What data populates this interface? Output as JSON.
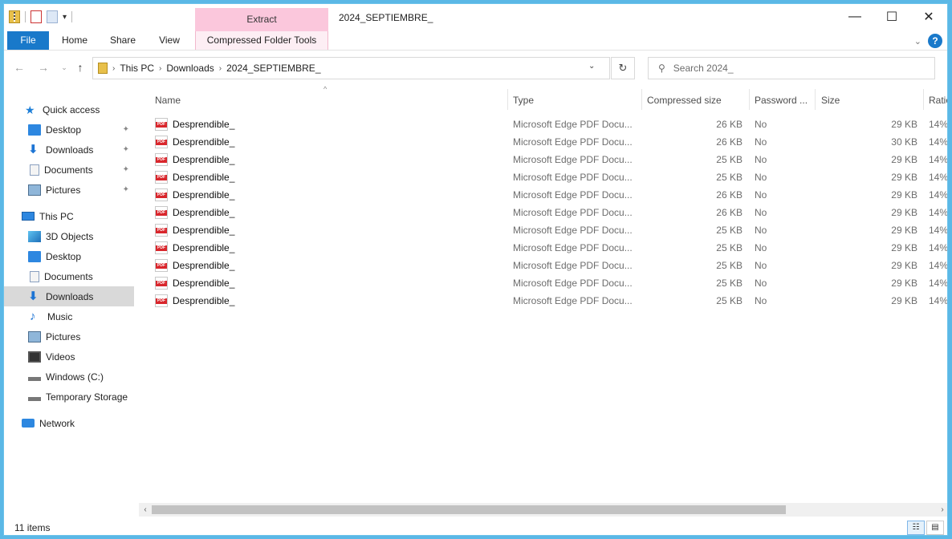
{
  "window": {
    "title": "2024_SEPTIEMBRE_",
    "context_tab_header": "Extract",
    "controls": {
      "minimize": "—",
      "maximize": "☐",
      "close": "✕"
    }
  },
  "ribbon": {
    "tabs": [
      "File",
      "Home",
      "Share",
      "View",
      "Compressed Folder Tools"
    ],
    "collapse": "⌄",
    "help": "?"
  },
  "address": {
    "crumbs": [
      "This PC",
      "Downloads",
      "2024_SEPTIEMBRE_"
    ],
    "separator": "›",
    "dropdown": "⌄",
    "refresh": "↻"
  },
  "search": {
    "placeholder": "Search 2024_",
    "icon": "⚲"
  },
  "nav": {
    "back": "←",
    "forward": "→",
    "recent": "⌄",
    "up": "↑"
  },
  "sidebar": {
    "items": [
      {
        "label": "Quick access",
        "icon": "star-icon",
        "pinned": false
      },
      {
        "label": "Desktop",
        "icon": "desktop-icon",
        "pinned": true
      },
      {
        "label": "Downloads",
        "icon": "downloads-icon",
        "pinned": true
      },
      {
        "label": "Documents",
        "icon": "documents-icon",
        "pinned": true
      },
      {
        "label": "Pictures",
        "icon": "pictures-icon",
        "pinned": true
      },
      {
        "label": "This PC",
        "icon": "pc-icon",
        "pinned": false
      },
      {
        "label": "3D Objects",
        "icon": "3d-objects-icon",
        "pinned": false
      },
      {
        "label": "Desktop",
        "icon": "desktop-icon",
        "pinned": false
      },
      {
        "label": "Documents",
        "icon": "documents-icon",
        "pinned": false
      },
      {
        "label": "Downloads",
        "icon": "downloads-icon",
        "pinned": false,
        "selected": true
      },
      {
        "label": "Music",
        "icon": "music-icon",
        "pinned": false
      },
      {
        "label": "Pictures",
        "icon": "pictures-icon",
        "pinned": false
      },
      {
        "label": "Videos",
        "icon": "videos-icon",
        "pinned": false
      },
      {
        "label": "Windows (C:)",
        "icon": "drive-icon",
        "pinned": false
      },
      {
        "label": "Temporary Storage",
        "icon": "drive-icon",
        "pinned": false
      },
      {
        "label": "Network",
        "icon": "network-icon",
        "pinned": false
      }
    ],
    "pin_glyph": "📌"
  },
  "columns": [
    "Name",
    "Type",
    "Compressed size",
    "Password ...",
    "Size",
    "Ratio"
  ],
  "sort_glyph": "^",
  "files": [
    {
      "name": "Desprendible_",
      "type": "Microsoft Edge PDF Docu...",
      "compressed": "26 KB",
      "password": "No",
      "size": "29 KB",
      "ratio": "14%"
    },
    {
      "name": "Desprendible_",
      "type": "Microsoft Edge PDF Docu...",
      "compressed": "26 KB",
      "password": "No",
      "size": "30 KB",
      "ratio": "14%"
    },
    {
      "name": "Desprendible_",
      "type": "Microsoft Edge PDF Docu...",
      "compressed": "25 KB",
      "password": "No",
      "size": "29 KB",
      "ratio": "14%"
    },
    {
      "name": "Desprendible_",
      "type": "Microsoft Edge PDF Docu...",
      "compressed": "25 KB",
      "password": "No",
      "size": "29 KB",
      "ratio": "14%"
    },
    {
      "name": "Desprendible_",
      "type": "Microsoft Edge PDF Docu...",
      "compressed": "26 KB",
      "password": "No",
      "size": "29 KB",
      "ratio": "14%"
    },
    {
      "name": "Desprendible_",
      "type": "Microsoft Edge PDF Docu...",
      "compressed": "26 KB",
      "password": "No",
      "size": "29 KB",
      "ratio": "14%"
    },
    {
      "name": "Desprendible_",
      "type": "Microsoft Edge PDF Docu...",
      "compressed": "25 KB",
      "password": "No",
      "size": "29 KB",
      "ratio": "14%"
    },
    {
      "name": "Desprendible_",
      "type": "Microsoft Edge PDF Docu...",
      "compressed": "25 KB",
      "password": "No",
      "size": "29 KB",
      "ratio": "14%"
    },
    {
      "name": "Desprendible_",
      "type": "Microsoft Edge PDF Docu...",
      "compressed": "25 KB",
      "password": "No",
      "size": "29 KB",
      "ratio": "14%"
    },
    {
      "name": "Desprendible_",
      "type": "Microsoft Edge PDF Docu...",
      "compressed": "25 KB",
      "password": "No",
      "size": "29 KB",
      "ratio": "14%"
    },
    {
      "name": "Desprendible_",
      "type": "Microsoft Edge PDF Docu...",
      "compressed": "25 KB",
      "password": "No",
      "size": "29 KB",
      "ratio": "14%"
    }
  ],
  "scroll": {
    "left": "‹",
    "right": "›"
  },
  "status": {
    "count": "11 items",
    "details_view": "☷",
    "tiles_view": "▤"
  },
  "colors": {
    "accent": "#1979ca",
    "context_tab": "#fbc7dc",
    "selected": "#d9d9d9",
    "frame": "#5bb8e6"
  }
}
